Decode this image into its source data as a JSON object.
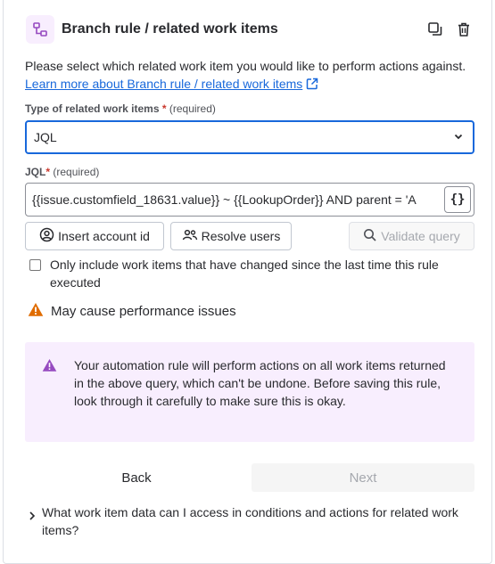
{
  "header": {
    "title": "Branch rule / related work items",
    "icons": {
      "branch": "branch-icon",
      "duplicate": "duplicate-icon",
      "delete": "trash-icon"
    }
  },
  "description": {
    "text": "Please select which related work item you would like to perform actions against. ",
    "link": "Learn more about Branch rule / related work items"
  },
  "type_field": {
    "label": "Type of related work items",
    "required_mark": "*",
    "required_text": "(required)",
    "value": "JQL"
  },
  "jql_field": {
    "label": "JQL",
    "required_mark": "*",
    "required_text": "(required)",
    "value": "{{issue.customfield_18631.value}} ~ {{LookupOrder}} AND parent = 'A",
    "smart_values_label": "{}"
  },
  "buttons": {
    "insert_account": "Insert account id",
    "resolve_users": "Resolve users",
    "validate_query": "Validate query"
  },
  "checkbox": {
    "label": "Only include work items that have changed since the last time this rule executed",
    "checked": false
  },
  "warning": {
    "text": "May cause performance issues",
    "color": "#e06c00"
  },
  "info": {
    "text": "Your automation rule will perform actions on all work items returned in the above query, which can't be undone. Before saving this rule, look through it carefully to make sure this is okay.",
    "bg": "#f8eefe",
    "accent": "#964ac0"
  },
  "footer": {
    "back": "Back",
    "next": "Next"
  },
  "faq": {
    "text": "What work item data can I access in conditions and actions for related work items?"
  },
  "colors": {
    "link": "#1868db",
    "focus_border": "#1868db",
    "required": "#c9372c"
  }
}
